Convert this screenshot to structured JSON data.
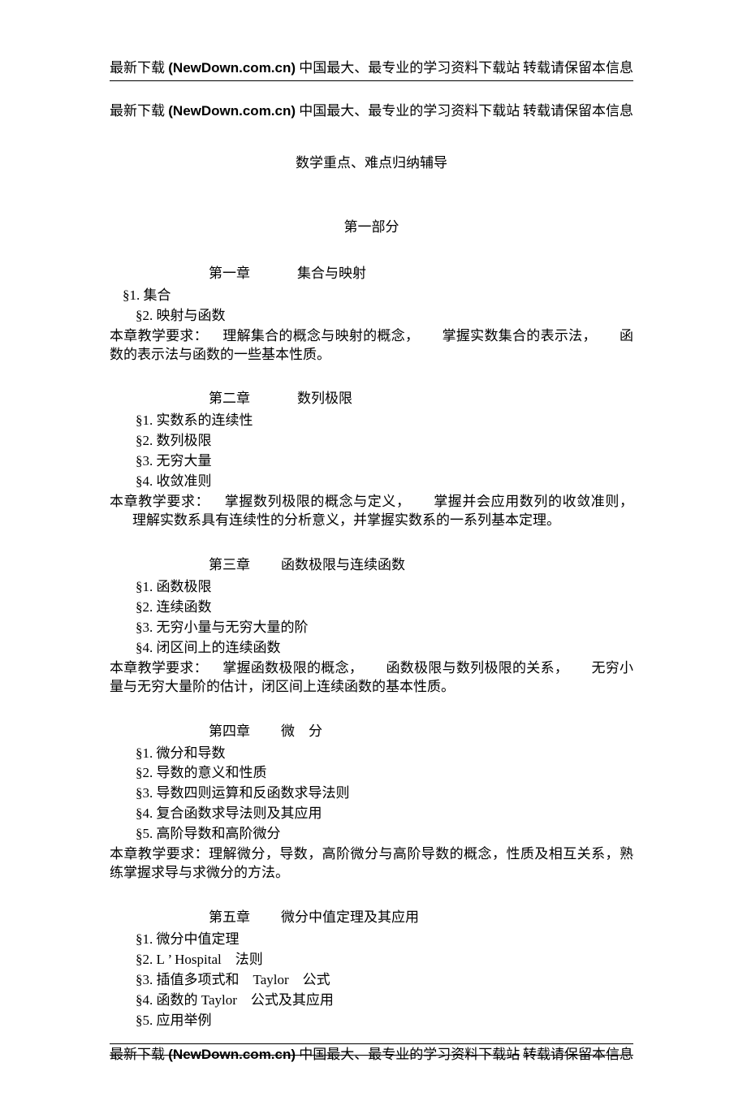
{
  "header": {
    "left_prefix": "最新下载 ",
    "left_bold": "(NewDown.com.cn)",
    "left_suffix": " 中国最大、最专业的学习资料下载站",
    "right": "转载请保留本信息"
  },
  "doc_title": "数学重点、难点归纳辅导",
  "part_label": "第一部分",
  "chapters": [
    {
      "label": "第一章",
      "title": "集合与映射",
      "first_sec_outdent": true,
      "sections": [
        "§1. 集合",
        "§2. 映射与函数"
      ],
      "req_lead": "本章教学要求：",
      "req_segments": [
        "理解集合的概念与映射的概念，",
        "掌握实数集合的表示法，",
        "函数的表示法与函数的一些基本性质。"
      ]
    },
    {
      "label": "第二章",
      "title": "数列极限",
      "sections": [
        "§1. 实数系的连续性",
        "§2. 数列极限",
        "§3. 无穷大量",
        "§4. 收敛准则"
      ],
      "req_lead": "本章教学要求：",
      "req_segments": [
        "掌握数列极限的概念与定义，",
        "掌握并会应用数列的收敛准则，",
        "理解实数系具有连续性的分析意义，并掌握实数系的一系列基本定理。"
      ]
    },
    {
      "label": "第三章",
      "title": "函数极限与连续函数",
      "title_gap": 38,
      "sections": [
        "§1. 函数极限",
        "§2. 连续函数",
        "§3. 无穷小量与无穷大量的阶",
        "§4. 闭区间上的连续函数"
      ],
      "req_lead": "本章教学要求：",
      "req_segments": [
        "掌握函数极限的概念，",
        "函数极限与数列极限的关系，",
        "无穷小量与无穷大量阶的估计，闭区间上连续函数的基本性质。"
      ]
    },
    {
      "label": "第四章",
      "title": "微　分",
      "title_gap": 38,
      "sections": [
        "§1. 微分和导数",
        "§2. 导数的意义和性质",
        "§3. 导数四则运算和反函数求导法则",
        "§4. 复合函数求导法则及其应用",
        "§5. 高阶导数和高阶微分"
      ],
      "req_lead": "本章教学要求：理解微分，导数，高阶微分与高阶导数的概念，性质及相互关系，熟练掌握求导与求微分的方法。",
      "req_segments": []
    },
    {
      "label": "第五章",
      "title": "微分中值定理及其应用",
      "title_gap": 38,
      "sections": [
        "§1. 微分中值定理",
        "§2. L ’ Hospital　法则",
        "§3. 插值多项式和　Taylor　公式",
        "§4. 函数的 Taylor　公式及其应用",
        "§5. 应用举例"
      ],
      "no_req": true
    }
  ]
}
